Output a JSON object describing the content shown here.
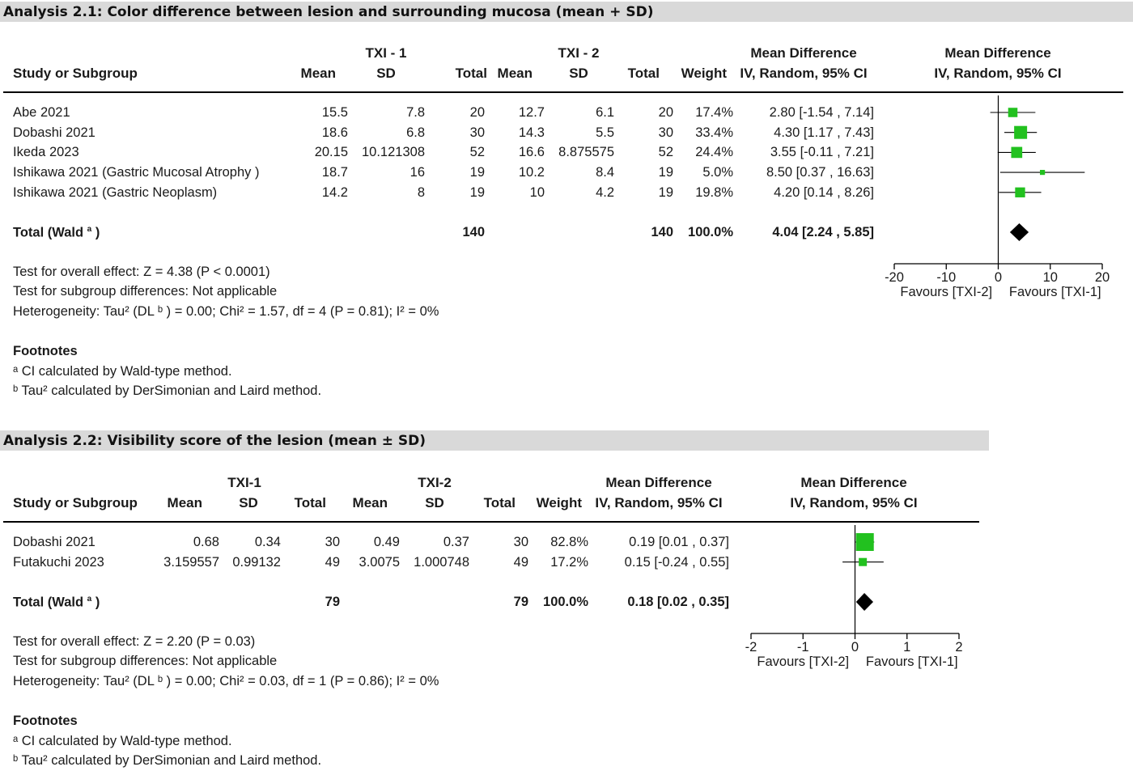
{
  "chart_data": [
    {
      "type": "forest",
      "title": "Analysis 2.1: Color difference between lesion and surrounding mucosa (mean + SD)",
      "group1_label": "TXI - 1",
      "group2_label": "TXI - 2",
      "columns": {
        "study": "Study or Subgroup",
        "mean": "Mean",
        "sd": "SD",
        "total": "Total",
        "weight": "Weight",
        "md_title": "Mean Difference",
        "md_method": "IV, Random, 95% CI"
      },
      "studies": [
        {
          "name": "Abe 2021",
          "m1": "15.5",
          "sd1": "7.8",
          "n1": "20",
          "m2": "12.7",
          "sd2": "6.1",
          "n2": "20",
          "weight": "17.4%",
          "ci_text": "2.80 [-1.54 , 7.14]",
          "md": 2.8,
          "lo": -1.54,
          "hi": 7.14,
          "w": 17.4
        },
        {
          "name": "Dobashi 2021",
          "m1": "18.6",
          "sd1": "6.8",
          "n1": "30",
          "m2": "14.3",
          "sd2": "5.5",
          "n2": "30",
          "weight": "33.4%",
          "ci_text": "4.30 [1.17 , 7.43]",
          "md": 4.3,
          "lo": 1.17,
          "hi": 7.43,
          "w": 33.4
        },
        {
          "name": "Ikeda 2023",
          "m1": "20.15",
          "sd1": "10.121308",
          "n1": "52",
          "m2": "16.6",
          "sd2": "8.875575",
          "n2": "52",
          "weight": "24.4%",
          "ci_text": "3.55 [-0.11 , 7.21]",
          "md": 3.55,
          "lo": -0.11,
          "hi": 7.21,
          "w": 24.4
        },
        {
          "name": "Ishikawa 2021 (Gastric Mucosal Atrophy )",
          "m1": "18.7",
          "sd1": "16",
          "n1": "19",
          "m2": "10.2",
          "sd2": "8.4",
          "n2": "19",
          "weight": "5.0%",
          "ci_text": "8.50 [0.37 , 16.63]",
          "md": 8.5,
          "lo": 0.37,
          "hi": 16.63,
          "w": 5.0
        },
        {
          "name": "Ishikawa 2021 (Gastric Neoplasm)",
          "m1": "14.2",
          "sd1": "8",
          "n1": "19",
          "m2": "10",
          "sd2": "4.2",
          "n2": "19",
          "weight": "19.8%",
          "ci_text": "4.20 [0.14 , 8.26]",
          "md": 4.2,
          "lo": 0.14,
          "hi": 8.26,
          "w": 19.8
        }
      ],
      "total": {
        "label": "Total (Wald",
        "sup": "a",
        "close": ")",
        "n1": "140",
        "n2": "140",
        "weight": "100.0%",
        "ci_text": "4.04 [2.24 , 5.85]",
        "md": 4.04,
        "lo": 2.24,
        "hi": 5.85
      },
      "stats": [
        "Test for overall effect: Z = 4.38 (P < 0.0001)",
        "Test for subgroup differences: Not applicable",
        "Heterogeneity: Tau² (DL ᵇ ) = 0.00; Chi² = 1.57, df = 4 (P = 0.81); I² = 0%"
      ],
      "axis": {
        "ticks": [
          -20,
          -10,
          0,
          10,
          20
        ],
        "tick_labels": [
          "-20",
          "-10",
          "0",
          "10",
          "20"
        ],
        "xlim": [
          -20,
          20
        ],
        "left_label": "Favours [TXI-2]",
        "right_label": "Favours [TXI-1]"
      },
      "footnotes_title": "Footnotes",
      "footnotes": [
        "ᵃ CI calculated by Wald-type method.",
        "ᵇ Tau² calculated by DerSimonian and Laird method."
      ]
    },
    {
      "type": "forest",
      "title": "Analysis 2.2: Visibility score of the lesion (mean ± SD)",
      "group1_label": "TXI-1",
      "group2_label": "TXI-2",
      "columns": {
        "study": "Study or Subgroup",
        "mean": "Mean",
        "sd": "SD",
        "total": "Total",
        "weight": "Weight",
        "md_title": "Mean Difference",
        "md_method": "IV, Random, 95% CI"
      },
      "studies": [
        {
          "name": "Dobashi 2021",
          "m1": "0.68",
          "sd1": "0.34",
          "n1": "30",
          "m2": "0.49",
          "sd2": "0.37",
          "n2": "30",
          "weight": "82.8%",
          "ci_text": "0.19 [0.01 , 0.37]",
          "md": 0.19,
          "lo": 0.01,
          "hi": 0.37,
          "w": 82.8
        },
        {
          "name": "Futakuchi 2023",
          "m1": "3.159557",
          "sd1": "0.99132",
          "n1": "49",
          "m2": "3.0075",
          "sd2": "1.000748",
          "n2": "49",
          "weight": "17.2%",
          "ci_text": "0.15 [-0.24 , 0.55]",
          "md": 0.15,
          "lo": -0.24,
          "hi": 0.55,
          "w": 17.2
        }
      ],
      "total": {
        "label": "Total (Wald",
        "sup": "a",
        "close": ")",
        "n1": "79",
        "n2": "79",
        "weight": "100.0%",
        "ci_text": "0.18 [0.02 , 0.35]",
        "md": 0.18,
        "lo": 0.02,
        "hi": 0.35
      },
      "stats": [
        "Test for overall effect: Z = 2.20 (P = 0.03)",
        "Test for subgroup differences: Not applicable",
        "Heterogeneity: Tau² (DL ᵇ ) = 0.00; Chi² = 0.03, df = 1 (P = 0.86); I² = 0%"
      ],
      "axis": {
        "ticks": [
          -2,
          -1,
          0,
          1,
          2
        ],
        "tick_labels": [
          "-2",
          "-1",
          "0",
          "1",
          "2"
        ],
        "xlim": [
          -2,
          2
        ],
        "left_label": "Favours [TXI-2]",
        "right_label": "Favours [TXI-1]"
      },
      "footnotes_title": "Footnotes",
      "footnotes": [
        "ᵃ CI calculated by Wald-type method.",
        "ᵇ Tau² calculated by DerSimonian and Laird method."
      ]
    }
  ],
  "colors": {
    "marker": "#22c11f",
    "diamond": "#000000",
    "title_bar": "#d9d9d9"
  }
}
